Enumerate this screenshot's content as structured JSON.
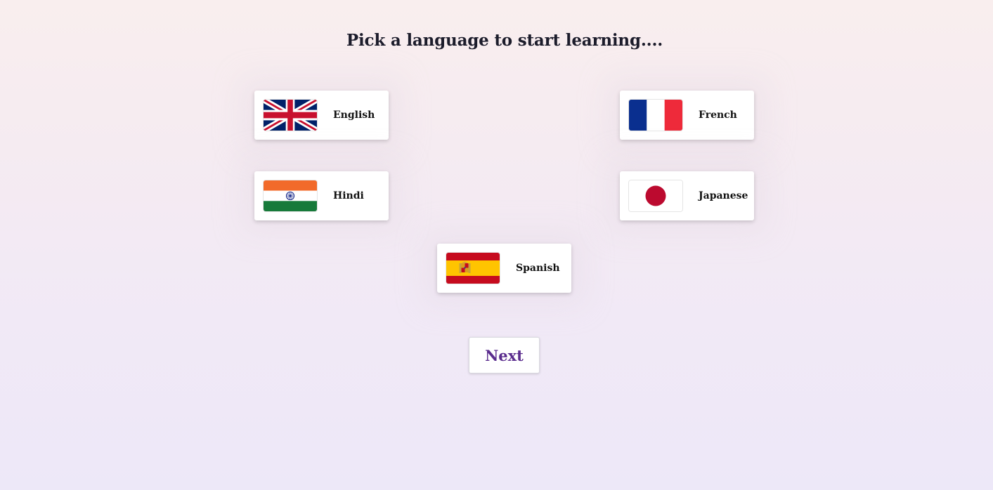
{
  "heading": "Pick a language to start learning....",
  "languages": [
    {
      "label": "English",
      "flag_icon": "uk-flag-icon"
    },
    {
      "label": "French",
      "flag_icon": "france-flag-icon"
    },
    {
      "label": "Hindi",
      "flag_icon": "india-flag-icon"
    },
    {
      "label": "Japanese",
      "flag_icon": "japan-flag-icon"
    },
    {
      "label": "Spanish",
      "flag_icon": "spain-flag-icon"
    }
  ],
  "next_label": "Next",
  "colors": {
    "accent": "#5b2d8e",
    "title": "#1c1c2b"
  }
}
